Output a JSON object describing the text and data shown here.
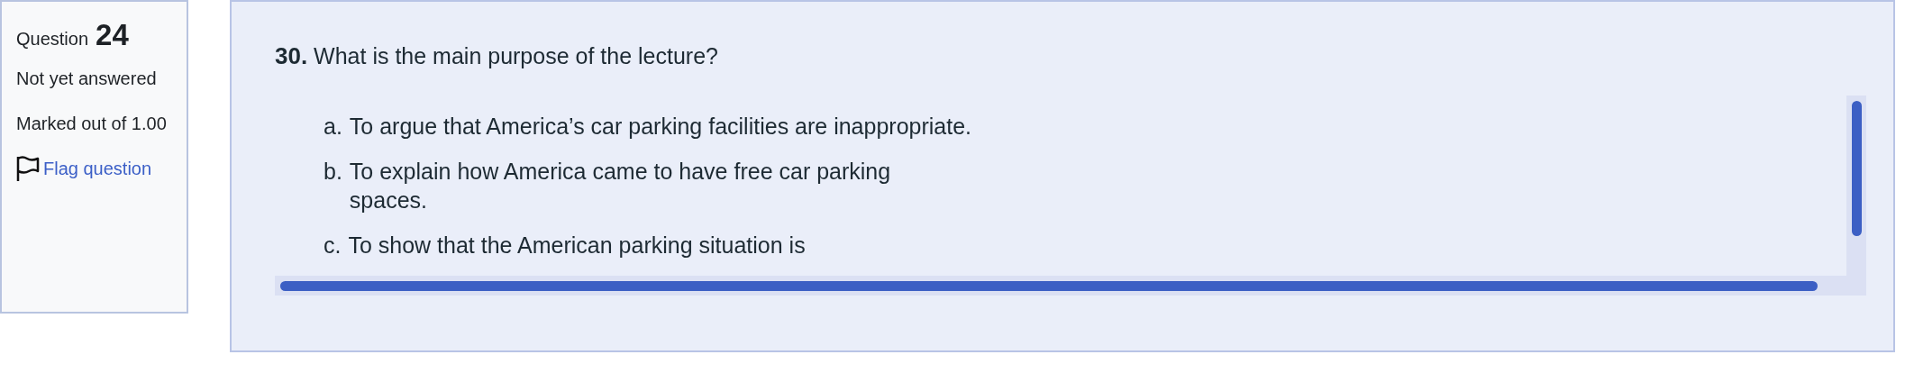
{
  "info": {
    "label": "Question",
    "number": "24",
    "status": "Not yet answered",
    "marks": "Marked out of 1.00",
    "flag": "Flag question"
  },
  "question": {
    "number": "30.",
    "text": "What is the main purpose of the lecture?",
    "options": [
      {
        "letter": "a.",
        "lines": [
          "To argue that America’s car parking facilities are inappropriate."
        ]
      },
      {
        "letter": "b.",
        "lines": [
          "To explain how America came to have free car parking",
          "spaces."
        ]
      },
      {
        "letter": "c.",
        "lines": [
          "To show that the American parking situation is"
        ]
      }
    ]
  }
}
